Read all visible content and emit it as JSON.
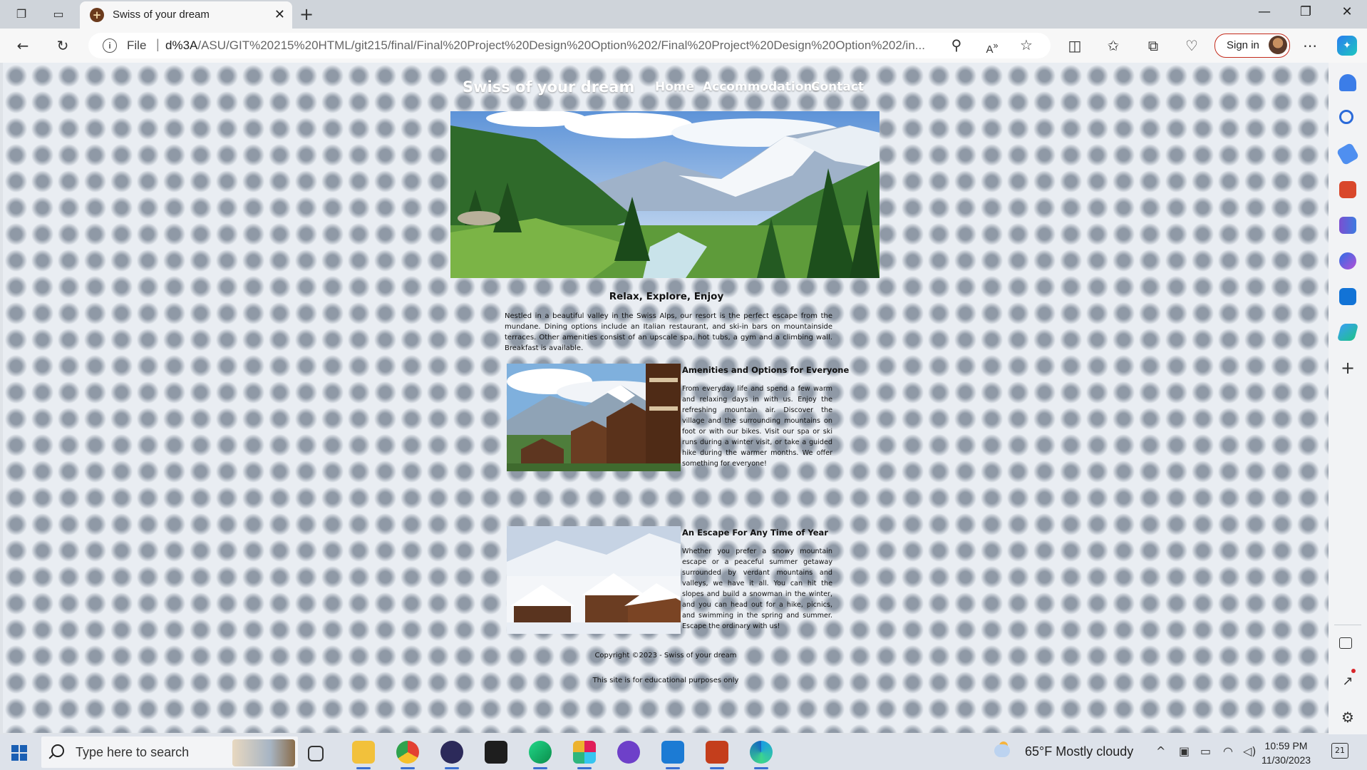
{
  "browser": {
    "tab_title": "Swiss of your dream",
    "address_scheme": "File",
    "address_url_host": "d%3A",
    "address_url_path": "/ASU/GIT%20215%20HTML/git215/final/Final%20Project%20Design%20Option%202/Final%20Project%20Design%20Option%202/in...",
    "sign_in_label": "Sign in"
  },
  "site": {
    "title": "Swiss of your dream",
    "nav": [
      "Home",
      "Accommodations",
      "Contact"
    ],
    "headline": "Relax, Explore, Enjoy",
    "intro": "Nestled in a beautiful valley in the Swiss Alps, our resort is the perfect escape from the mundane. Dining options include an Italian restaurant, and ski-in bars on mountainside terraces. Other amenities consist of an upscale spa, hot tubs, a gym and a climbing wall. Breakfast is available.",
    "sections": [
      {
        "title": "Amenities and Options for Everyone",
        "body": "From everyday life and spend a few warm and relaxing days in with us. Enjoy the refreshing mountain air. Discover the village and the surrounding mountains on foot or with our bikes. Visit our spa or ski runs during a winter visit, or take a guided hike during the warmer months. We offer something for everyone!"
      },
      {
        "title": "An Escape For Any Time of Year",
        "body": "Whether you prefer a snowy mountain escape or a peaceful summer getaway surrounded by verdant mountains and valleys, we have it all. You can hit the slopes and build a snowman in the winter, and you can head out for a hike, picnics, and swimming in the spring and summer. Escape the ordinary with us!"
      }
    ],
    "footer_copyright": "Copyright ©2023 - Swiss of your dream",
    "footer_note": "This site is for educational purposes only"
  },
  "taskbar": {
    "search_placeholder": "Type here to search",
    "weather": "65°F  Mostly cloudy",
    "time": "10:59 PM",
    "date": "11/30/2023",
    "notification_count": "21",
    "apps": [
      "file-explorer",
      "chrome",
      "eclipse",
      "terminal",
      "pycharm",
      "slack",
      "github-desktop",
      "vscode",
      "powerpoint",
      "edge"
    ]
  },
  "colors": {
    "page_bg": "#7d8896",
    "pattern_cross": "#e9edf2",
    "sign_in_border": "#c42b1c",
    "accent": "#3a6fd1"
  }
}
